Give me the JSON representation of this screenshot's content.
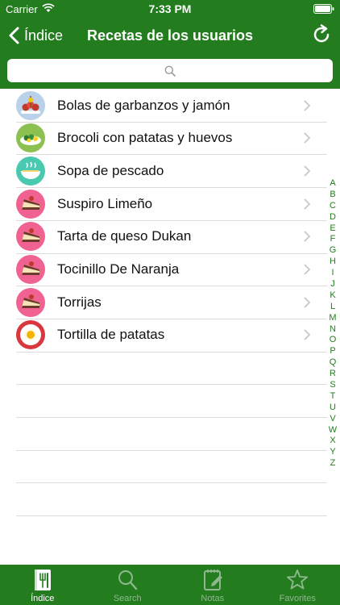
{
  "status": {
    "carrier": "Carrier",
    "time": "7:33 PM"
  },
  "nav": {
    "back_label": "Índice",
    "title": "Recetas de los usuarios"
  },
  "search": {
    "placeholder": ""
  },
  "recipes": [
    {
      "label": "Bolas de garbanzos y jamón",
      "icon": "tapas-skewer-icon",
      "bg": "#b9d2e9"
    },
    {
      "label": "Brocoli con patatas y huevos",
      "icon": "vegetable-dish-icon",
      "bg": "#8cc152"
    },
    {
      "label": "Sopa de pescado",
      "icon": "soup-bowl-icon",
      "bg": "#48c9b0"
    },
    {
      "label": "Suspiro Limeño",
      "icon": "cake-slice-icon",
      "bg": "#f06292"
    },
    {
      "label": "Tarta de queso Dukan",
      "icon": "cake-slice-icon",
      "bg": "#f06292"
    },
    {
      "label": "Tocinillo De Naranja",
      "icon": "cake-slice-icon",
      "bg": "#f06292"
    },
    {
      "label": "Torrijas",
      "icon": "cake-slice-icon",
      "bg": "#f06292"
    },
    {
      "label": "Tortilla de patatas",
      "icon": "fried-egg-plate-icon",
      "bg": "#d9363e"
    }
  ],
  "index_letters": [
    "A",
    "B",
    "C",
    "D",
    "E",
    "F",
    "G",
    "H",
    "I",
    "J",
    "K",
    "L",
    "M",
    "N",
    "O",
    "P",
    "Q",
    "R",
    "S",
    "T",
    "U",
    "V",
    "W",
    "X",
    "Y",
    "Z"
  ],
  "tabs": [
    {
      "label": "Índice",
      "icon": "recipe-book-icon",
      "active": true
    },
    {
      "label": "Search",
      "icon": "search-icon",
      "active": false
    },
    {
      "label": "Notas",
      "icon": "notepad-icon",
      "active": false
    },
    {
      "label": "Favorites",
      "icon": "star-icon",
      "active": false
    }
  ],
  "colors": {
    "brand_green": "#237d1f",
    "index_green": "#237d1f",
    "inactive_tab": "#8fb88e"
  }
}
